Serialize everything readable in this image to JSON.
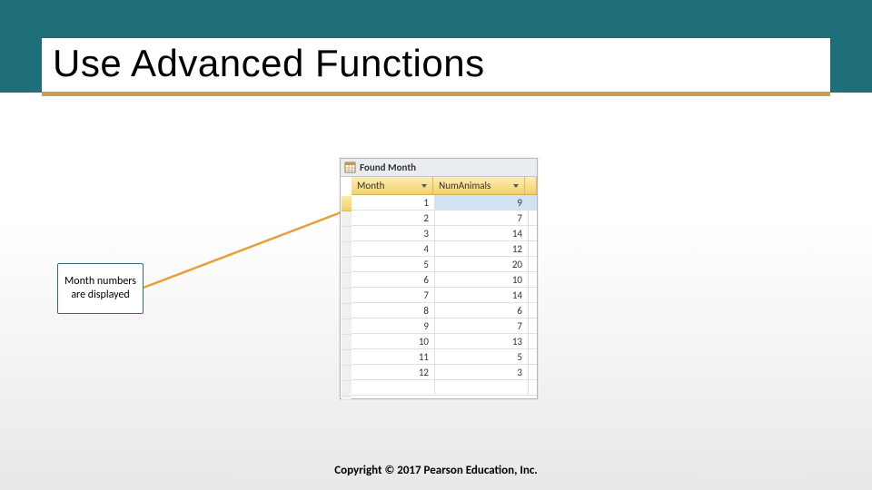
{
  "slide": {
    "title": "Use Advanced Functions",
    "callout": "Month numbers are displayed",
    "copyright": "Copyright © 2017 Pearson Education, Inc."
  },
  "datasheet": {
    "tab_label": "Found Month",
    "columns": {
      "month": "Month",
      "num": "NumAnimals"
    },
    "rows": [
      {
        "month": "1",
        "num": "9"
      },
      {
        "month": "2",
        "num": "7"
      },
      {
        "month": "3",
        "num": "14"
      },
      {
        "month": "4",
        "num": "12"
      },
      {
        "month": "5",
        "num": "20"
      },
      {
        "month": "6",
        "num": "10"
      },
      {
        "month": "7",
        "num": "14"
      },
      {
        "month": "8",
        "num": "6"
      },
      {
        "month": "9",
        "num": "7"
      },
      {
        "month": "10",
        "num": "13"
      },
      {
        "month": "11",
        "num": "5"
      },
      {
        "month": "12",
        "num": "3"
      }
    ]
  }
}
